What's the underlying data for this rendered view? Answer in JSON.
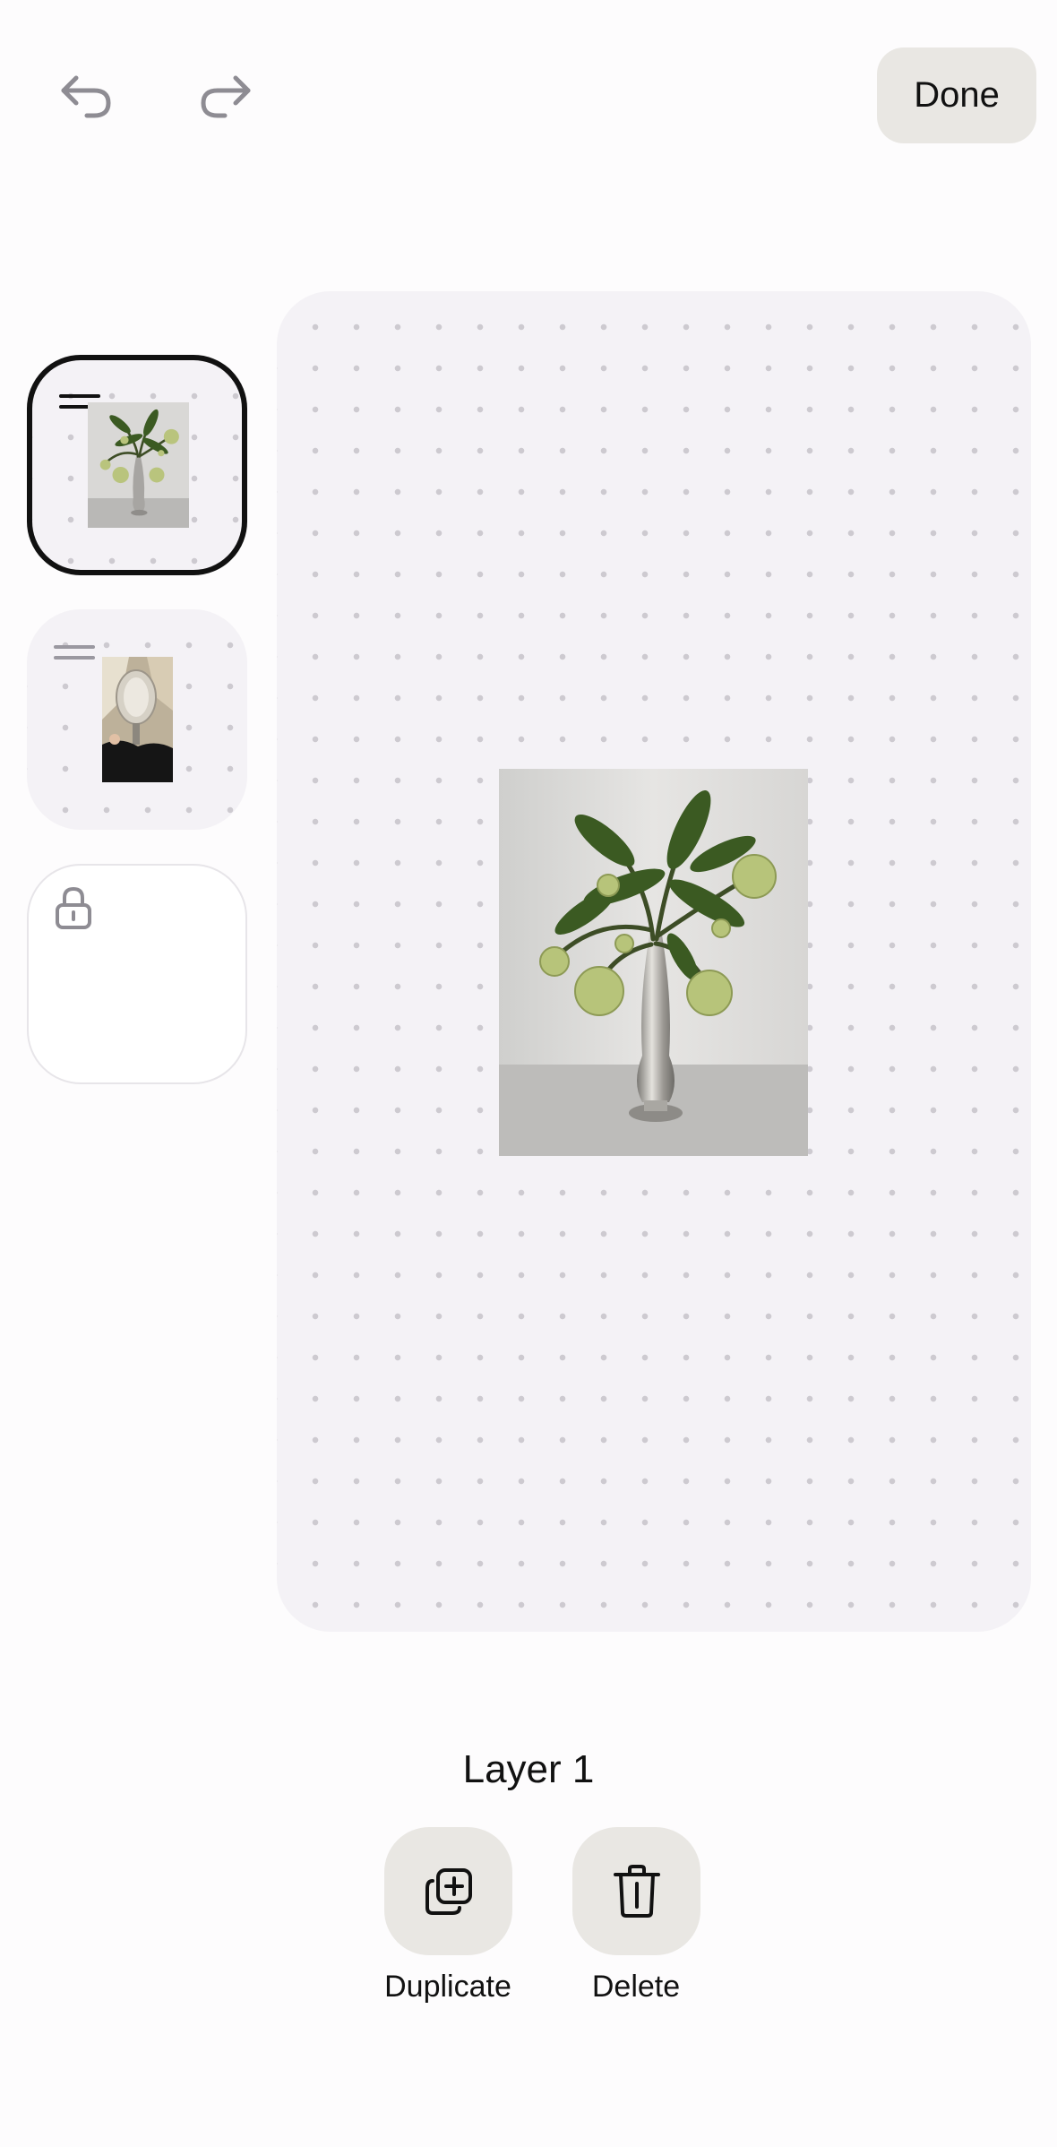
{
  "header": {
    "undo_icon": "undo-arrow-icon",
    "redo_icon": "redo-arrow-icon",
    "done_label": "Done"
  },
  "layers": [
    {
      "thumbnail": "vase-with-hellebore-flowers",
      "selected": true,
      "handle_icon": "drag-handle-icon"
    },
    {
      "thumbnail": "person-holding-mirror-with-vase",
      "selected": false,
      "handle_icon": "drag-handle-icon"
    },
    {
      "thumbnail": "empty",
      "locked": true,
      "lock_icon": "lock-icon"
    }
  ],
  "editor": {
    "layer_title": "Layer 1",
    "actions": [
      {
        "label": "Duplicate",
        "icon": "duplicate-icon"
      },
      {
        "label": "Delete",
        "icon": "trash-icon"
      }
    ]
  },
  "colors": {
    "background": "#fdfcfd",
    "canvas": "#f4f2f6",
    "button": "#e9e7e3",
    "selected_border": "#111111"
  }
}
